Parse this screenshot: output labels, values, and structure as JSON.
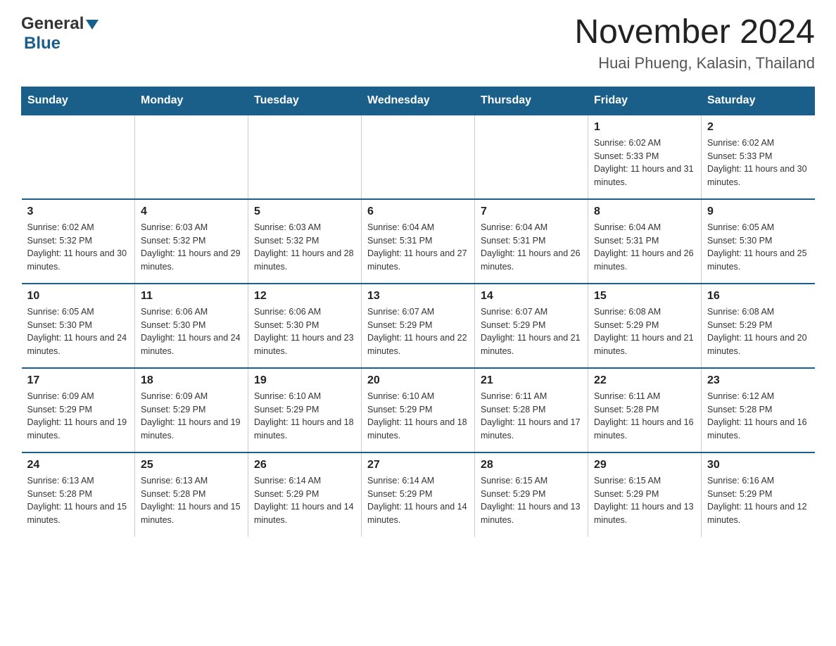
{
  "header": {
    "logo_general": "General",
    "logo_blue": "Blue",
    "month_title": "November 2024",
    "location": "Huai Phueng, Kalasin, Thailand"
  },
  "days_of_week": [
    "Sunday",
    "Monday",
    "Tuesday",
    "Wednesday",
    "Thursday",
    "Friday",
    "Saturday"
  ],
  "weeks": [
    [
      {
        "day": "",
        "sunrise": "",
        "sunset": "",
        "daylight": ""
      },
      {
        "day": "",
        "sunrise": "",
        "sunset": "",
        "daylight": ""
      },
      {
        "day": "",
        "sunrise": "",
        "sunset": "",
        "daylight": ""
      },
      {
        "day": "",
        "sunrise": "",
        "sunset": "",
        "daylight": ""
      },
      {
        "day": "",
        "sunrise": "",
        "sunset": "",
        "daylight": ""
      },
      {
        "day": "1",
        "sunrise": "Sunrise: 6:02 AM",
        "sunset": "Sunset: 5:33 PM",
        "daylight": "Daylight: 11 hours and 31 minutes."
      },
      {
        "day": "2",
        "sunrise": "Sunrise: 6:02 AM",
        "sunset": "Sunset: 5:33 PM",
        "daylight": "Daylight: 11 hours and 30 minutes."
      }
    ],
    [
      {
        "day": "3",
        "sunrise": "Sunrise: 6:02 AM",
        "sunset": "Sunset: 5:32 PM",
        "daylight": "Daylight: 11 hours and 30 minutes."
      },
      {
        "day": "4",
        "sunrise": "Sunrise: 6:03 AM",
        "sunset": "Sunset: 5:32 PM",
        "daylight": "Daylight: 11 hours and 29 minutes."
      },
      {
        "day": "5",
        "sunrise": "Sunrise: 6:03 AM",
        "sunset": "Sunset: 5:32 PM",
        "daylight": "Daylight: 11 hours and 28 minutes."
      },
      {
        "day": "6",
        "sunrise": "Sunrise: 6:04 AM",
        "sunset": "Sunset: 5:31 PM",
        "daylight": "Daylight: 11 hours and 27 minutes."
      },
      {
        "day": "7",
        "sunrise": "Sunrise: 6:04 AM",
        "sunset": "Sunset: 5:31 PM",
        "daylight": "Daylight: 11 hours and 26 minutes."
      },
      {
        "day": "8",
        "sunrise": "Sunrise: 6:04 AM",
        "sunset": "Sunset: 5:31 PM",
        "daylight": "Daylight: 11 hours and 26 minutes."
      },
      {
        "day": "9",
        "sunrise": "Sunrise: 6:05 AM",
        "sunset": "Sunset: 5:30 PM",
        "daylight": "Daylight: 11 hours and 25 minutes."
      }
    ],
    [
      {
        "day": "10",
        "sunrise": "Sunrise: 6:05 AM",
        "sunset": "Sunset: 5:30 PM",
        "daylight": "Daylight: 11 hours and 24 minutes."
      },
      {
        "day": "11",
        "sunrise": "Sunrise: 6:06 AM",
        "sunset": "Sunset: 5:30 PM",
        "daylight": "Daylight: 11 hours and 24 minutes."
      },
      {
        "day": "12",
        "sunrise": "Sunrise: 6:06 AM",
        "sunset": "Sunset: 5:30 PM",
        "daylight": "Daylight: 11 hours and 23 minutes."
      },
      {
        "day": "13",
        "sunrise": "Sunrise: 6:07 AM",
        "sunset": "Sunset: 5:29 PM",
        "daylight": "Daylight: 11 hours and 22 minutes."
      },
      {
        "day": "14",
        "sunrise": "Sunrise: 6:07 AM",
        "sunset": "Sunset: 5:29 PM",
        "daylight": "Daylight: 11 hours and 21 minutes."
      },
      {
        "day": "15",
        "sunrise": "Sunrise: 6:08 AM",
        "sunset": "Sunset: 5:29 PM",
        "daylight": "Daylight: 11 hours and 21 minutes."
      },
      {
        "day": "16",
        "sunrise": "Sunrise: 6:08 AM",
        "sunset": "Sunset: 5:29 PM",
        "daylight": "Daylight: 11 hours and 20 minutes."
      }
    ],
    [
      {
        "day": "17",
        "sunrise": "Sunrise: 6:09 AM",
        "sunset": "Sunset: 5:29 PM",
        "daylight": "Daylight: 11 hours and 19 minutes."
      },
      {
        "day": "18",
        "sunrise": "Sunrise: 6:09 AM",
        "sunset": "Sunset: 5:29 PM",
        "daylight": "Daylight: 11 hours and 19 minutes."
      },
      {
        "day": "19",
        "sunrise": "Sunrise: 6:10 AM",
        "sunset": "Sunset: 5:29 PM",
        "daylight": "Daylight: 11 hours and 18 minutes."
      },
      {
        "day": "20",
        "sunrise": "Sunrise: 6:10 AM",
        "sunset": "Sunset: 5:29 PM",
        "daylight": "Daylight: 11 hours and 18 minutes."
      },
      {
        "day": "21",
        "sunrise": "Sunrise: 6:11 AM",
        "sunset": "Sunset: 5:28 PM",
        "daylight": "Daylight: 11 hours and 17 minutes."
      },
      {
        "day": "22",
        "sunrise": "Sunrise: 6:11 AM",
        "sunset": "Sunset: 5:28 PM",
        "daylight": "Daylight: 11 hours and 16 minutes."
      },
      {
        "day": "23",
        "sunrise": "Sunrise: 6:12 AM",
        "sunset": "Sunset: 5:28 PM",
        "daylight": "Daylight: 11 hours and 16 minutes."
      }
    ],
    [
      {
        "day": "24",
        "sunrise": "Sunrise: 6:13 AM",
        "sunset": "Sunset: 5:28 PM",
        "daylight": "Daylight: 11 hours and 15 minutes."
      },
      {
        "day": "25",
        "sunrise": "Sunrise: 6:13 AM",
        "sunset": "Sunset: 5:28 PM",
        "daylight": "Daylight: 11 hours and 15 minutes."
      },
      {
        "day": "26",
        "sunrise": "Sunrise: 6:14 AM",
        "sunset": "Sunset: 5:29 PM",
        "daylight": "Daylight: 11 hours and 14 minutes."
      },
      {
        "day": "27",
        "sunrise": "Sunrise: 6:14 AM",
        "sunset": "Sunset: 5:29 PM",
        "daylight": "Daylight: 11 hours and 14 minutes."
      },
      {
        "day": "28",
        "sunrise": "Sunrise: 6:15 AM",
        "sunset": "Sunset: 5:29 PM",
        "daylight": "Daylight: 11 hours and 13 minutes."
      },
      {
        "day": "29",
        "sunrise": "Sunrise: 6:15 AM",
        "sunset": "Sunset: 5:29 PM",
        "daylight": "Daylight: 11 hours and 13 minutes."
      },
      {
        "day": "30",
        "sunrise": "Sunrise: 6:16 AM",
        "sunset": "Sunset: 5:29 PM",
        "daylight": "Daylight: 11 hours and 12 minutes."
      }
    ]
  ]
}
